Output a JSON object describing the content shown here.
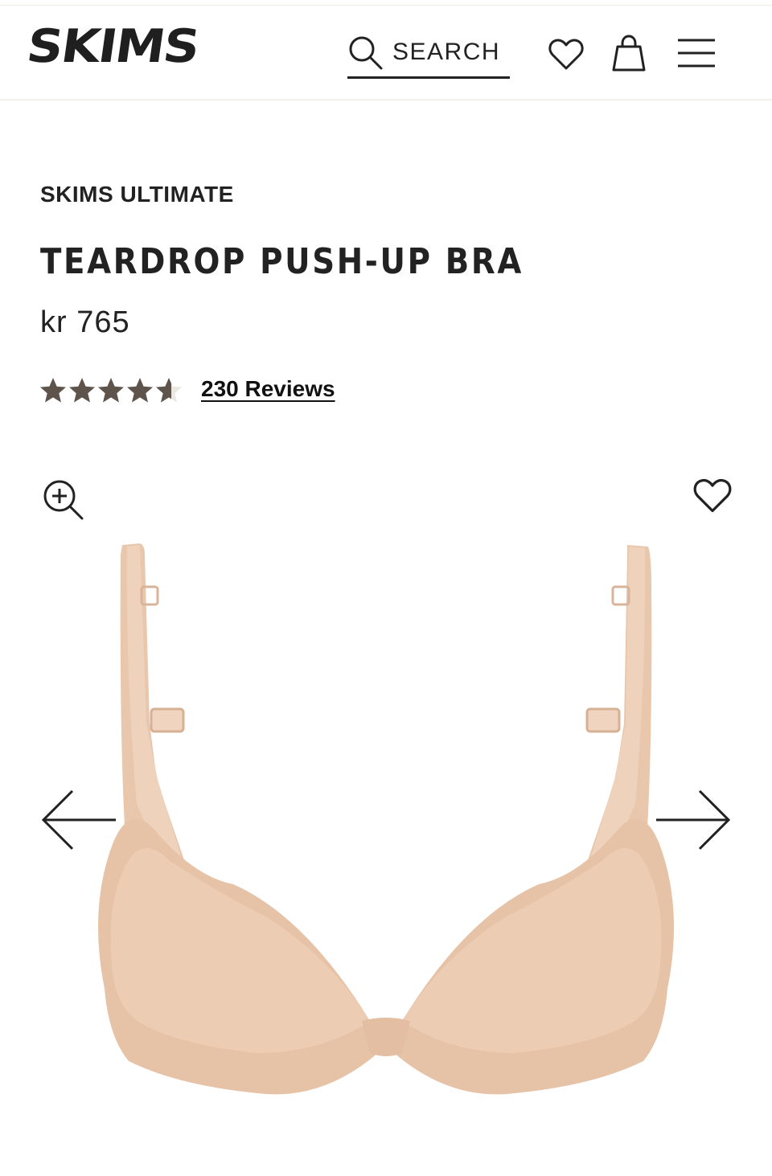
{
  "header": {
    "logo_text": "SKIMS",
    "search_label": "SEARCH",
    "icons": [
      "search-icon",
      "heart-icon",
      "bag-icon",
      "menu-icon"
    ]
  },
  "product": {
    "collection": "SKIMS ULTIMATE",
    "title": "TEARDROP PUSH-UP BRA",
    "price": "kr 765",
    "rating": 4.5,
    "rating_max": 5,
    "reviews_label": "230 Reviews"
  },
  "gallery": {
    "icons": [
      "zoom-in-icon",
      "heart-icon",
      "arrow-left-icon",
      "arrow-right-icon"
    ],
    "image_alt": "Teardrop push-up bra in nude"
  },
  "colors": {
    "text": "#222222",
    "star": "#5e544c",
    "product_tone": "#e9c7ad",
    "divider": "#f2efe9"
  }
}
